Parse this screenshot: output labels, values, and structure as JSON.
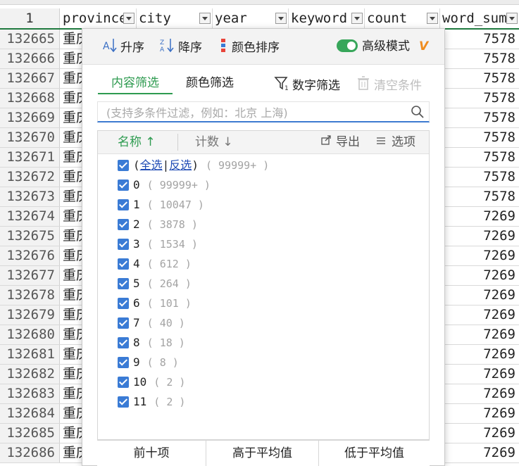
{
  "sheet": {
    "header_row_num": "1",
    "columns": [
      {
        "name": "province"
      },
      {
        "name": "city"
      },
      {
        "name": "year"
      },
      {
        "name": "keyword"
      },
      {
        "name": "count"
      },
      {
        "name": "word_sum"
      }
    ],
    "rows": [
      {
        "num": "132665",
        "prov": "重庆",
        "ws": "7578"
      },
      {
        "num": "132666",
        "prov": "重庆",
        "ws": "7578"
      },
      {
        "num": "132667",
        "prov": "重庆",
        "ws": "7578"
      },
      {
        "num": "132668",
        "prov": "重庆",
        "ws": "7578"
      },
      {
        "num": "132669",
        "prov": "重庆",
        "ws": "7578"
      },
      {
        "num": "132670",
        "prov": "重庆",
        "ws": "7578"
      },
      {
        "num": "132671",
        "prov": "重庆",
        "ws": "7578"
      },
      {
        "num": "132672",
        "prov": "重庆",
        "ws": "7578"
      },
      {
        "num": "132673",
        "prov": "重庆",
        "ws": "7578"
      },
      {
        "num": "132674",
        "prov": "重庆",
        "ws": "7269"
      },
      {
        "num": "132675",
        "prov": "重庆",
        "ws": "7269"
      },
      {
        "num": "132676",
        "prov": "重庆",
        "ws": "7269"
      },
      {
        "num": "132677",
        "prov": "重庆",
        "ws": "7269"
      },
      {
        "num": "132678",
        "prov": "重庆",
        "ws": "7269"
      },
      {
        "num": "132679",
        "prov": "重庆",
        "ws": "7269"
      },
      {
        "num": "132680",
        "prov": "重庆",
        "ws": "7269"
      },
      {
        "num": "132681",
        "prov": "重庆",
        "ws": "7269"
      },
      {
        "num": "132682",
        "prov": "重庆",
        "ws": "7269"
      },
      {
        "num": "132683",
        "prov": "重庆",
        "ws": "7269"
      },
      {
        "num": "132684",
        "prov": "重庆",
        "ws": "7269"
      },
      {
        "num": "132685",
        "prov": "重庆",
        "ws": "7269"
      },
      {
        "num": "132686",
        "prov": "重庆",
        "ws": "7269"
      }
    ]
  },
  "filter": {
    "toolbar": {
      "asc": "升序",
      "desc": "降序",
      "color_sort": "颜色排序",
      "advanced": "高级模式",
      "vip": "V",
      "accent_color": "#37a65a"
    },
    "tabs": {
      "content": "内容筛选",
      "color": "颜色筛选",
      "number": "数字筛选",
      "clear": "清空条件"
    },
    "search_placeholder": "(支持多条件过滤，例如：北京 上海)",
    "list_header": {
      "name": "名称",
      "name_arrow": "↑",
      "count": "计数",
      "count_arrow": "↓",
      "export": "导出",
      "options": "选项"
    },
    "select_all": {
      "open": "(",
      "all": "全选",
      "sep": "|",
      "invert": "反选",
      "close": ")",
      "count": "( 99999+ )"
    },
    "items": [
      {
        "label": "0",
        "count": "( 99999+ )"
      },
      {
        "label": "1",
        "count": "( 10047 )"
      },
      {
        "label": "2",
        "count": "( 3878 )"
      },
      {
        "label": "3",
        "count": "( 1534 )"
      },
      {
        "label": "4",
        "count": "( 612 )"
      },
      {
        "label": "5",
        "count": "( 264 )"
      },
      {
        "label": "6",
        "count": "( 101 )"
      },
      {
        "label": "7",
        "count": "( 40 )"
      },
      {
        "label": "8",
        "count": "( 18 )"
      },
      {
        "label": "9",
        "count": "( 8 )"
      },
      {
        "label": "10",
        "count": "( 2 )"
      },
      {
        "label": "11",
        "count": "( 2 )"
      }
    ],
    "bottom": {
      "top10": "前十项",
      "above_avg": "高于平均值",
      "below_avg": "低于平均值"
    }
  }
}
